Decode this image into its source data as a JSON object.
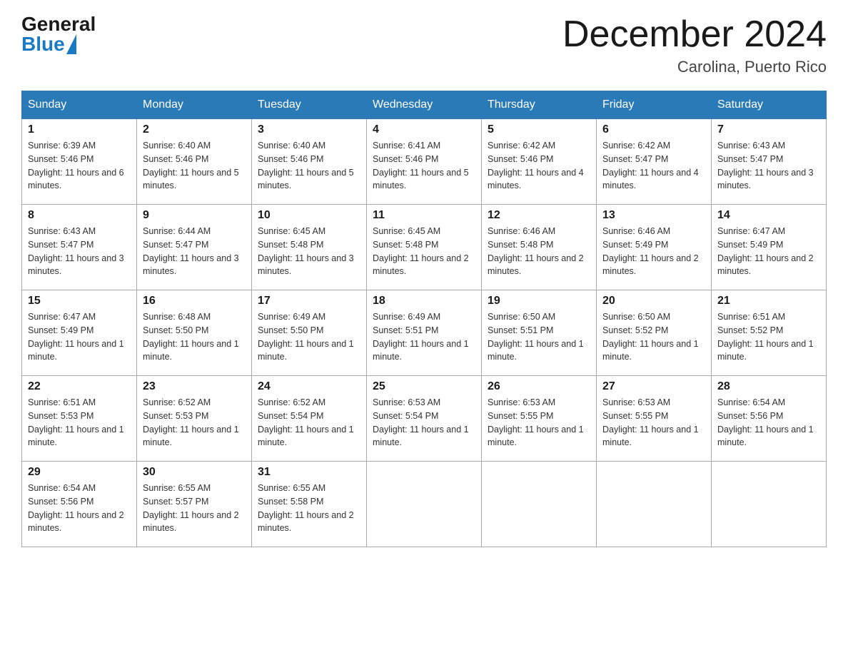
{
  "logo": {
    "general": "General",
    "blue": "Blue"
  },
  "title": {
    "month": "December 2024",
    "location": "Carolina, Puerto Rico"
  },
  "headers": [
    "Sunday",
    "Monday",
    "Tuesday",
    "Wednesday",
    "Thursday",
    "Friday",
    "Saturday"
  ],
  "weeks": [
    [
      {
        "day": "1",
        "sunrise": "6:39 AM",
        "sunset": "5:46 PM",
        "daylight": "11 hours and 6 minutes."
      },
      {
        "day": "2",
        "sunrise": "6:40 AM",
        "sunset": "5:46 PM",
        "daylight": "11 hours and 5 minutes."
      },
      {
        "day": "3",
        "sunrise": "6:40 AM",
        "sunset": "5:46 PM",
        "daylight": "11 hours and 5 minutes."
      },
      {
        "day": "4",
        "sunrise": "6:41 AM",
        "sunset": "5:46 PM",
        "daylight": "11 hours and 5 minutes."
      },
      {
        "day": "5",
        "sunrise": "6:42 AM",
        "sunset": "5:46 PM",
        "daylight": "11 hours and 4 minutes."
      },
      {
        "day": "6",
        "sunrise": "6:42 AM",
        "sunset": "5:47 PM",
        "daylight": "11 hours and 4 minutes."
      },
      {
        "day": "7",
        "sunrise": "6:43 AM",
        "sunset": "5:47 PM",
        "daylight": "11 hours and 3 minutes."
      }
    ],
    [
      {
        "day": "8",
        "sunrise": "6:43 AM",
        "sunset": "5:47 PM",
        "daylight": "11 hours and 3 minutes."
      },
      {
        "day": "9",
        "sunrise": "6:44 AM",
        "sunset": "5:47 PM",
        "daylight": "11 hours and 3 minutes."
      },
      {
        "day": "10",
        "sunrise": "6:45 AM",
        "sunset": "5:48 PM",
        "daylight": "11 hours and 3 minutes."
      },
      {
        "day": "11",
        "sunrise": "6:45 AM",
        "sunset": "5:48 PM",
        "daylight": "11 hours and 2 minutes."
      },
      {
        "day": "12",
        "sunrise": "6:46 AM",
        "sunset": "5:48 PM",
        "daylight": "11 hours and 2 minutes."
      },
      {
        "day": "13",
        "sunrise": "6:46 AM",
        "sunset": "5:49 PM",
        "daylight": "11 hours and 2 minutes."
      },
      {
        "day": "14",
        "sunrise": "6:47 AM",
        "sunset": "5:49 PM",
        "daylight": "11 hours and 2 minutes."
      }
    ],
    [
      {
        "day": "15",
        "sunrise": "6:47 AM",
        "sunset": "5:49 PM",
        "daylight": "11 hours and 1 minute."
      },
      {
        "day": "16",
        "sunrise": "6:48 AM",
        "sunset": "5:50 PM",
        "daylight": "11 hours and 1 minute."
      },
      {
        "day": "17",
        "sunrise": "6:49 AM",
        "sunset": "5:50 PM",
        "daylight": "11 hours and 1 minute."
      },
      {
        "day": "18",
        "sunrise": "6:49 AM",
        "sunset": "5:51 PM",
        "daylight": "11 hours and 1 minute."
      },
      {
        "day": "19",
        "sunrise": "6:50 AM",
        "sunset": "5:51 PM",
        "daylight": "11 hours and 1 minute."
      },
      {
        "day": "20",
        "sunrise": "6:50 AM",
        "sunset": "5:52 PM",
        "daylight": "11 hours and 1 minute."
      },
      {
        "day": "21",
        "sunrise": "6:51 AM",
        "sunset": "5:52 PM",
        "daylight": "11 hours and 1 minute."
      }
    ],
    [
      {
        "day": "22",
        "sunrise": "6:51 AM",
        "sunset": "5:53 PM",
        "daylight": "11 hours and 1 minute."
      },
      {
        "day": "23",
        "sunrise": "6:52 AM",
        "sunset": "5:53 PM",
        "daylight": "11 hours and 1 minute."
      },
      {
        "day": "24",
        "sunrise": "6:52 AM",
        "sunset": "5:54 PM",
        "daylight": "11 hours and 1 minute."
      },
      {
        "day": "25",
        "sunrise": "6:53 AM",
        "sunset": "5:54 PM",
        "daylight": "11 hours and 1 minute."
      },
      {
        "day": "26",
        "sunrise": "6:53 AM",
        "sunset": "5:55 PM",
        "daylight": "11 hours and 1 minute."
      },
      {
        "day": "27",
        "sunrise": "6:53 AM",
        "sunset": "5:55 PM",
        "daylight": "11 hours and 1 minute."
      },
      {
        "day": "28",
        "sunrise": "6:54 AM",
        "sunset": "5:56 PM",
        "daylight": "11 hours and 1 minute."
      }
    ],
    [
      {
        "day": "29",
        "sunrise": "6:54 AM",
        "sunset": "5:56 PM",
        "daylight": "11 hours and 2 minutes."
      },
      {
        "day": "30",
        "sunrise": "6:55 AM",
        "sunset": "5:57 PM",
        "daylight": "11 hours and 2 minutes."
      },
      {
        "day": "31",
        "sunrise": "6:55 AM",
        "sunset": "5:58 PM",
        "daylight": "11 hours and 2 minutes."
      },
      null,
      null,
      null,
      null
    ]
  ],
  "labels": {
    "sunrise": "Sunrise:",
    "sunset": "Sunset:",
    "daylight": "Daylight:"
  }
}
